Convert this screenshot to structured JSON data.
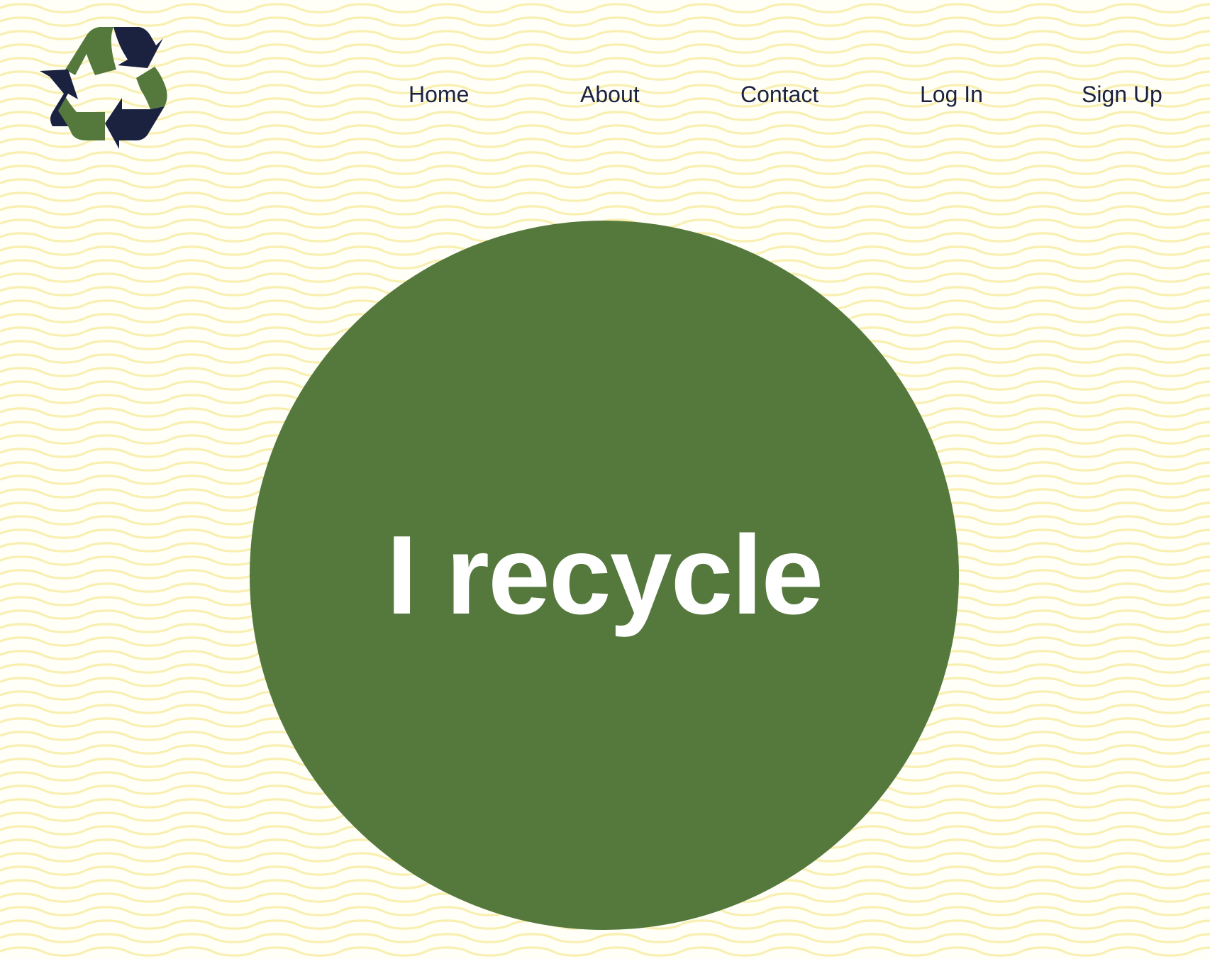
{
  "colors": {
    "background": "#fffff7",
    "wave_line": "#f8efb0",
    "brand_green": "#55793d",
    "navy": "#1b2240",
    "text_on_green": "#ffffff"
  },
  "header": {
    "logo": {
      "icon": "recycle-icon"
    },
    "nav": {
      "home": "Home",
      "about": "About",
      "contact": "Contact",
      "login": "Log In",
      "signup": "Sign Up"
    }
  },
  "hero": {
    "title": "I recycle"
  }
}
